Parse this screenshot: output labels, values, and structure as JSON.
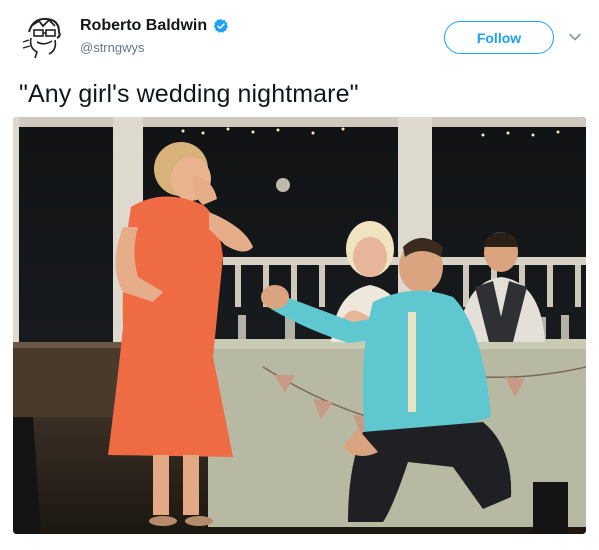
{
  "tweet": {
    "author": {
      "display_name": "Roberto Baldwin",
      "handle": "@strngwys",
      "verified": true,
      "avatar_icon": "sketch-portrait-avatar"
    },
    "follow_label": "Follow",
    "more_icon": "chevron-down-icon",
    "text": "\"Any girl's wedding nightmare\"",
    "media_icon": "photo-wedding-proposal"
  },
  "colors": {
    "accent": "#1da1f2",
    "text": "#14171a",
    "secondary_text": "#657786"
  }
}
